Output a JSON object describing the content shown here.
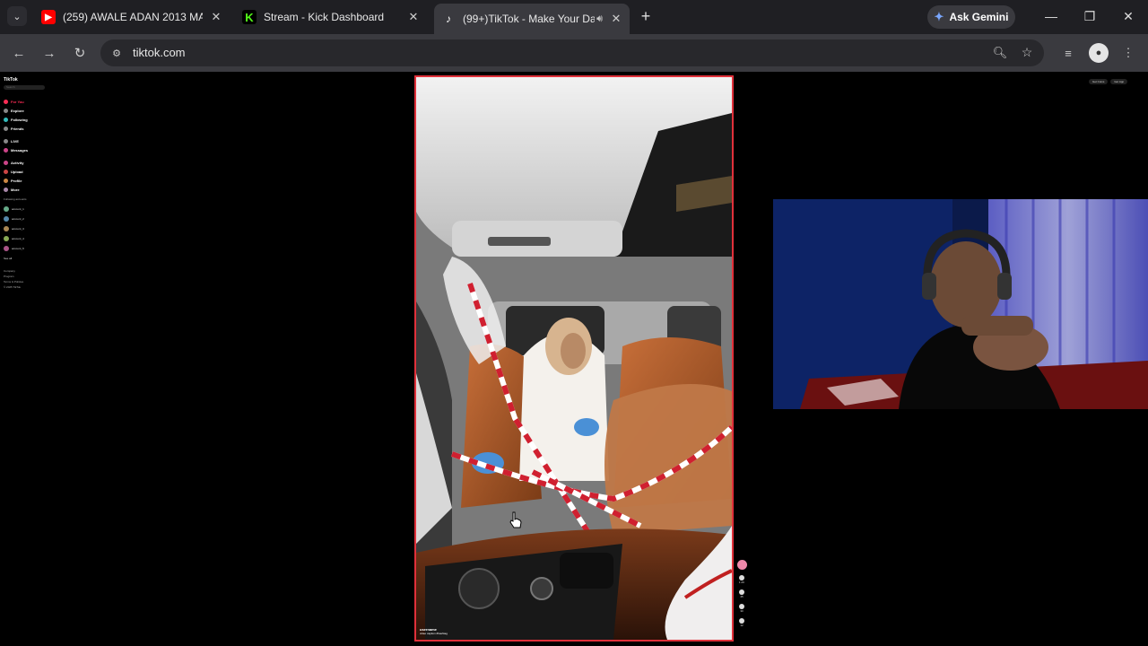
{
  "browser": {
    "tabs": [
      {
        "title": "(259) AWALE ADAN 2013 MAH",
        "favicon": "youtube-icon",
        "favicon_color": "#ff0000",
        "active": false
      },
      {
        "title": "Stream - Kick Dashboard",
        "favicon": "kick-icon",
        "favicon_color": "#53fc18",
        "active": false
      },
      {
        "title": "(99+)TikTok - Make Your Da",
        "favicon": "tiktok-icon",
        "favicon_color": "#ffffff",
        "active": true,
        "audio": true
      }
    ],
    "gemini_label": "Ask Gemini",
    "url": "tiktok.com"
  },
  "tiktok": {
    "logo": "TikTok",
    "search_placeholder": "Search",
    "nav": [
      {
        "label": "For You",
        "active": true
      },
      {
        "label": "Explore",
        "active": false
      },
      {
        "label": "Following",
        "active": false
      },
      {
        "label": "Friends",
        "active": false
      },
      {
        "label": "LIVE",
        "active": false
      },
      {
        "label": "Messages",
        "active": false
      },
      {
        "label": "Activity",
        "active": false
      },
      {
        "label": "Upload",
        "active": false
      },
      {
        "label": "Profile",
        "active": false
      },
      {
        "label": "More",
        "active": false
      }
    ],
    "following_title": "Following accounts",
    "following": [
      "account_1",
      "account_2",
      "account_3",
      "account_4",
      "account_5"
    ],
    "see_all": "See all",
    "footer": [
      "Company",
      "Program",
      "Terms & Policies",
      "© 2025 TikTok"
    ],
    "top_right": [
      "Get Coins",
      "Get App"
    ],
    "video": {
      "author": "username",
      "caption": "video caption #hashtag"
    },
    "actions": [
      {
        "name": "like-icon",
        "count": "1.2K"
      },
      {
        "name": "comment-icon",
        "count": "45"
      },
      {
        "name": "save-icon",
        "count": "30"
      },
      {
        "name": "share-icon",
        "count": "12"
      }
    ]
  },
  "colors": {
    "accent": "#fe2c55",
    "video_border": "#e0303a"
  }
}
